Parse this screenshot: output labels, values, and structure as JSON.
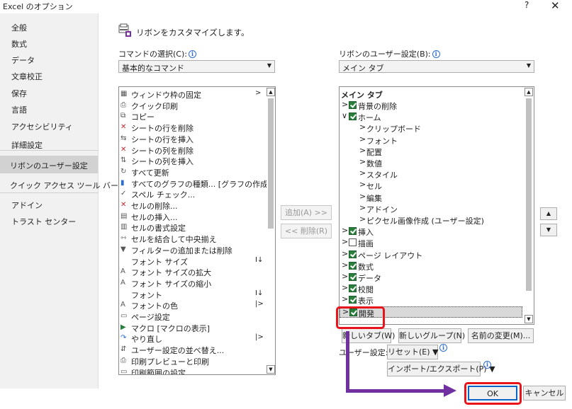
{
  "window": {
    "title": "Excel のオプション",
    "help": "?",
    "close": "✕"
  },
  "sidebar": {
    "items": [
      {
        "label": "全般"
      },
      {
        "label": "数式"
      },
      {
        "label": "データ"
      },
      {
        "label": "文章校正"
      },
      {
        "label": "保存"
      },
      {
        "label": "言語"
      },
      {
        "label": "アクセシビリティ"
      },
      {
        "label": "詳細設定"
      },
      {
        "label": "リボンのユーザー設定",
        "selected": true
      },
      {
        "label": "クイック アクセス ツール バー"
      },
      {
        "label": "アドイン"
      },
      {
        "label": "トラスト センター"
      }
    ]
  },
  "header": {
    "text": "リボンをカスタマイズします。"
  },
  "commands": {
    "label": "コマンドの選択(C):",
    "dropdown": "基本的なコマンド",
    "items": [
      {
        "label": "ウィンドウ枠の固定",
        "icon": "freeze-panes-icon",
        "sub": ">"
      },
      {
        "label": "クイック印刷",
        "icon": "quick-print-icon"
      },
      {
        "label": "コピー",
        "icon": "copy-icon"
      },
      {
        "label": "シートの行を削除",
        "icon": "delete-row-icon"
      },
      {
        "label": "シートの行を挿入",
        "icon": "insert-row-icon"
      },
      {
        "label": "シートの列を削除",
        "icon": "delete-column-icon"
      },
      {
        "label": "シートの列を挿入",
        "icon": "insert-column-icon"
      },
      {
        "label": "すべて更新",
        "icon": "refresh-all-icon"
      },
      {
        "label": "すべてのグラフの種類... [グラフの作成]",
        "icon": "chart-icon"
      },
      {
        "label": "スペル チェック...",
        "icon": "spell-check-icon"
      },
      {
        "label": "セルの削除...",
        "icon": "delete-cells-icon"
      },
      {
        "label": "セルの挿入...",
        "icon": "insert-cells-icon"
      },
      {
        "label": "セルの書式設定",
        "icon": "format-cells-icon"
      },
      {
        "label": "セルを結合して中央揃え",
        "icon": "merge-center-icon"
      },
      {
        "label": "フィルターの追加または削除",
        "icon": "filter-icon"
      },
      {
        "label": "フォント サイズ",
        "icon": "",
        "sub": "I↓"
      },
      {
        "label": "フォント サイズの拡大",
        "icon": "font-grow-icon"
      },
      {
        "label": "フォント サイズの縮小",
        "icon": "font-shrink-icon"
      },
      {
        "label": "フォント",
        "icon": "",
        "sub": "I↓"
      },
      {
        "label": "フォントの色",
        "icon": "font-color-icon",
        "sub": "|>"
      },
      {
        "label": "ページ設定",
        "icon": "page-setup-icon"
      },
      {
        "label": "マクロ [マクロの表示]",
        "icon": "macro-icon"
      },
      {
        "label": "やり直し",
        "icon": "redo-icon",
        "sub": "|>"
      },
      {
        "label": "ユーザー設定の並べ替え...",
        "icon": "custom-sort-icon"
      },
      {
        "label": "印刷プレビューと印刷",
        "icon": "print-preview-icon"
      },
      {
        "label": "印刷範囲の設定",
        "icon": "print-area-icon"
      }
    ]
  },
  "middle": {
    "add": "追加(A) >>",
    "remove": "<< 削除(R)"
  },
  "ribbon": {
    "label": "リボンのユーザー設定(B):",
    "dropdown": "メイン タブ",
    "heading": "メイン タブ",
    "items": [
      {
        "label": "背景の削除",
        "level": 0,
        "check": true
      },
      {
        "label": "ホーム",
        "level": 0,
        "check": true,
        "expanded": true
      },
      {
        "label": "クリップボード",
        "level": 1
      },
      {
        "label": "フォント",
        "level": 1
      },
      {
        "label": "配置",
        "level": 1
      },
      {
        "label": "数値",
        "level": 1
      },
      {
        "label": "スタイル",
        "level": 1
      },
      {
        "label": "セル",
        "level": 1
      },
      {
        "label": "編集",
        "level": 1
      },
      {
        "label": "アドイン",
        "level": 1
      },
      {
        "label": "ピクセル画像作成 (ユーザー設定)",
        "level": 1
      },
      {
        "label": "挿入",
        "level": 0,
        "check": true
      },
      {
        "label": "描画",
        "level": 0,
        "check": false
      },
      {
        "label": "ページ レイアウト",
        "level": 0,
        "check": true
      },
      {
        "label": "数式",
        "level": 0,
        "check": true
      },
      {
        "label": "データ",
        "level": 0,
        "check": true
      },
      {
        "label": "校閲",
        "level": 0,
        "check": true
      },
      {
        "label": "表示",
        "level": 0,
        "check": true
      },
      {
        "label": "開発",
        "level": 0,
        "check": true,
        "selected": true
      }
    ],
    "new_tab": "新しいタブ(W)",
    "new_group": "新しいグループ(N)",
    "rename": "名前の変更(M)...",
    "user_settings_label": "ユーザー設定:",
    "reset": "リセット(E) ▼",
    "import_export": "インポート/エクスポート(P) ▼",
    "up": "▲",
    "down": "▼"
  },
  "footer": {
    "ok": "OK",
    "cancel": "キャンセル"
  },
  "colors": {
    "annotation_red": "#e8141c",
    "annotation_purple": "#7030a0",
    "check_green": "#2a7f3c"
  }
}
